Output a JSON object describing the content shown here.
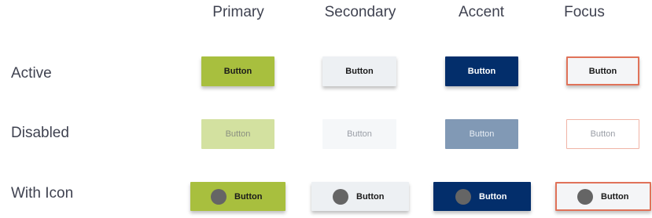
{
  "columns": [
    "Primary",
    "Secondary",
    "Accent",
    "Focus"
  ],
  "rows": [
    "Active",
    "Disabled",
    "With Icon"
  ],
  "button_label": "Button",
  "icon": "circle-icon",
  "colors": {
    "primary": "#a8bf3e",
    "secondary": "#edf0f3",
    "accent": "#032e6b",
    "focus_border": "#e07259",
    "icon_dot": "#656565"
  }
}
